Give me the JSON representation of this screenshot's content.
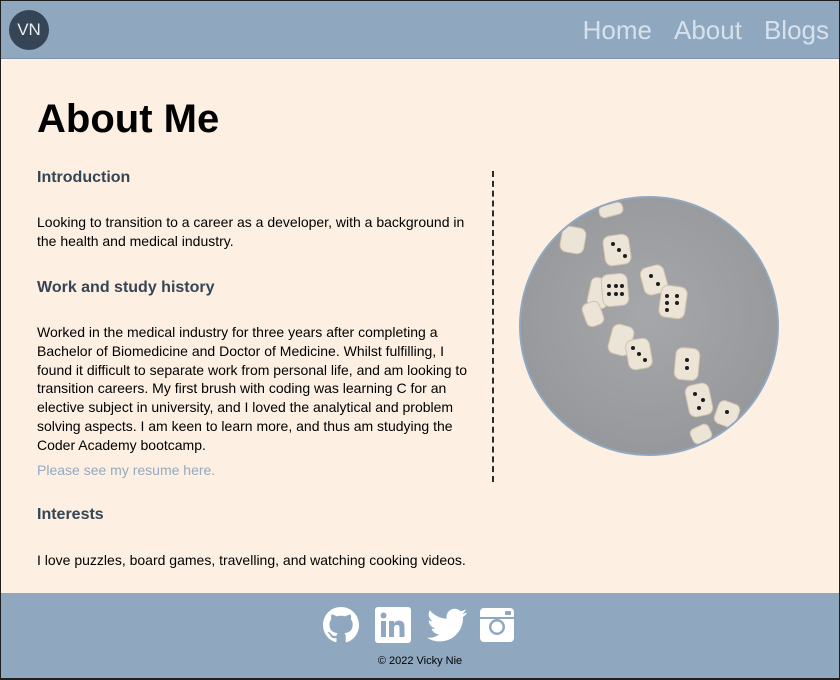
{
  "header": {
    "avatar_initials": "VN",
    "nav": [
      {
        "label": "Home"
      },
      {
        "label": "About"
      },
      {
        "label": "Blogs"
      }
    ]
  },
  "main": {
    "title": "About Me",
    "sections": [
      {
        "heading": "Introduction",
        "body": "Looking to transition to a career as a developer, with a background in the health and medical industry."
      },
      {
        "heading": "Work and study history",
        "body": "Worked in the medical industry for three years after completing a Bachelor of Biomedicine and Doctor of Medicine. Whilst fulfilling, I found it difficult to separate work from personal life, and am looking to transition careers. My first brush with coding was learning C for an elective subject in university, and I loved the analytical and problem solving aspects. I am keen to learn more, and thus am studying the Coder Academy bootcamp."
      },
      {
        "heading": "Interests",
        "body": "I love puzzles, board games, travelling, and watching cooking videos."
      }
    ],
    "resume_link": "Please see my resume here.",
    "photo_subject": "dice-photo"
  },
  "footer": {
    "socials": [
      {
        "icon": "github-icon"
      },
      {
        "icon": "linkedin-icon"
      },
      {
        "icon": "twitter-icon"
      },
      {
        "icon": "instagram-icon"
      }
    ],
    "copyright": "© 2022 Vicky Nie"
  },
  "colors": {
    "header_bg": "#8fa8c0",
    "page_bg": "#fdf0e3",
    "heading_text": "#354555",
    "link_text": "#93a9bf",
    "nav_text": "#d6e1ec"
  }
}
